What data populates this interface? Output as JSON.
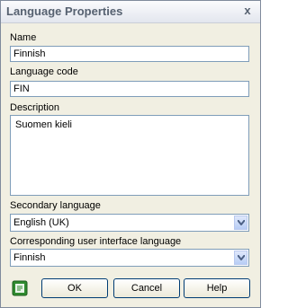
{
  "window": {
    "title": "Language Properties",
    "close_glyph": "x"
  },
  "fields": {
    "name": {
      "label": "Name",
      "value": "Finnish"
    },
    "language_code": {
      "label": "Language code",
      "value": "FIN"
    },
    "description": {
      "label": "Description",
      "value": "Suomen kieli"
    },
    "secondary_language": {
      "label": "Secondary language",
      "value": "English (UK)"
    },
    "ui_language": {
      "label": "Corresponding user interface language",
      "value": "Finnish"
    }
  },
  "buttons": {
    "ok": "OK",
    "cancel": "Cancel",
    "help": "Help"
  },
  "icons": {
    "help_book": "book-icon",
    "dropdown": "chevron-down-icon"
  }
}
